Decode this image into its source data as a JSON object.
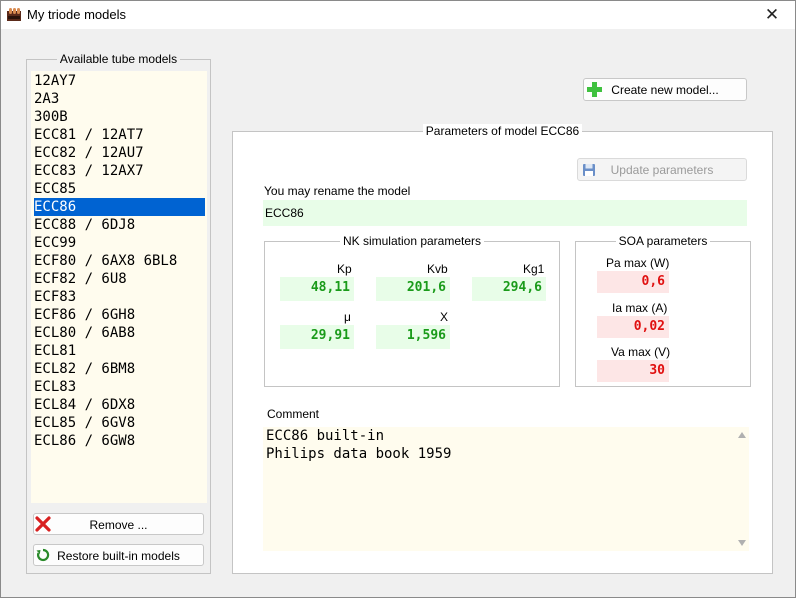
{
  "window": {
    "title": "My triode models",
    "close_glyph": "✕"
  },
  "models_panel": {
    "title": "Available tube models",
    "items": [
      "12AY7",
      "2A3",
      "300B",
      "ECC81 / 12AT7",
      "ECC82 / 12AU7",
      "ECC83 / 12AX7",
      "ECC85",
      "ECC86",
      "ECC88 / 6DJ8",
      "ECC99",
      "ECF80 / 6AX8 6BL8",
      "ECF82 / 6U8",
      "ECF83",
      "ECF86 / 6GH8",
      "ECL80 / 6AB8",
      "ECL81",
      "ECL82 / 6BM8",
      "ECL83",
      "ECL84 / 6DX8",
      "ECL85 / 6GV8",
      "ECL86 / 6GW8"
    ],
    "selected_item": "ECC86",
    "remove_label": "Remove ...",
    "restore_label": "Restore built-in models"
  },
  "create_button_label": "Create new model...",
  "parameters": {
    "title": "Parameters of model ECC86",
    "update_label": "Update parameters",
    "rename_label": "You may rename the model",
    "model_name": "ECC86",
    "nk": {
      "title": "NK simulation parameters",
      "kp_label": "Kp",
      "kp_value": "48,11",
      "kvb_label": "Kvb",
      "kvb_value": "201,6",
      "kg1_label": "Kg1",
      "kg1_value": "294,6",
      "mu_label": "μ",
      "mu_value": "29,91",
      "x_label": "X",
      "x_value": "1,596"
    },
    "soa": {
      "title": "SOA parameters",
      "pa_label": "Pa max (W)",
      "pa_value": "0,6",
      "ia_label": "Ia max (A)",
      "ia_value": "0,02",
      "va_label": "Va max (V)",
      "va_value": "30"
    },
    "comment_label": "Comment",
    "comment_text": "ECC86 built-in\nPhilips data book 1959"
  },
  "colors": {
    "selection": "#0063d2",
    "green_field_bg": "#e8fde8",
    "green_text": "#1a9b1a",
    "red_field_bg": "#fde6e6",
    "red_text": "#e01010",
    "list_bg": "#fffcee"
  }
}
